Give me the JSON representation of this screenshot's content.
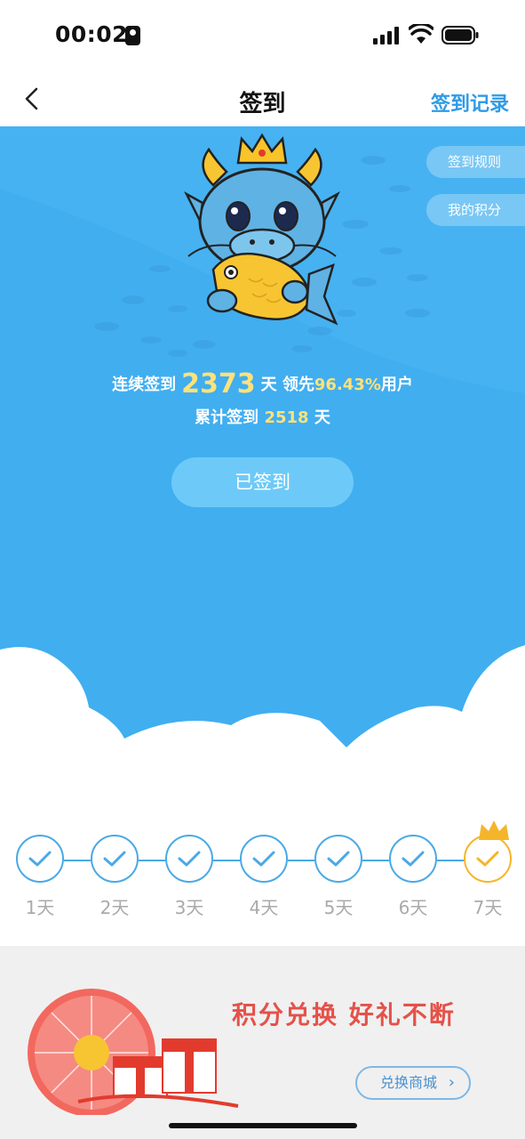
{
  "status": {
    "time": "00:02",
    "icons": [
      "portrait-badge-icon",
      "signal-icon",
      "wifi-icon",
      "battery-icon"
    ]
  },
  "nav": {
    "title": "签到",
    "record_label": "签到记录"
  },
  "hero": {
    "rules_label": "签到规则",
    "points_label": "我的积分",
    "streak_prefix": "连续签到",
    "streak_days": "2373",
    "streak_unit": "天",
    "lead_prefix": "领先",
    "lead_percent": "96.43%",
    "lead_suffix": "用户",
    "total_prefix": "累计签到",
    "total_days": "2518",
    "total_unit": "天",
    "signed_button": "已签到"
  },
  "days": [
    {
      "label": "1天",
      "done": true
    },
    {
      "label": "2天",
      "done": true
    },
    {
      "label": "3天",
      "done": true
    },
    {
      "label": "4天",
      "done": true
    },
    {
      "label": "5天",
      "done": true
    },
    {
      "label": "6天",
      "done": true
    },
    {
      "label": "7天",
      "done": true,
      "special": "crown"
    }
  ],
  "banner": {
    "title": "积分兑换 好礼不断",
    "button_label": "兑换商城"
  },
  "colors": {
    "hero_blue": "#41aef0",
    "accent_yellow": "#ffe27a",
    "check_blue": "#4aa9e6",
    "crown_gold": "#f5b52b",
    "banner_red": "#e4524a"
  }
}
